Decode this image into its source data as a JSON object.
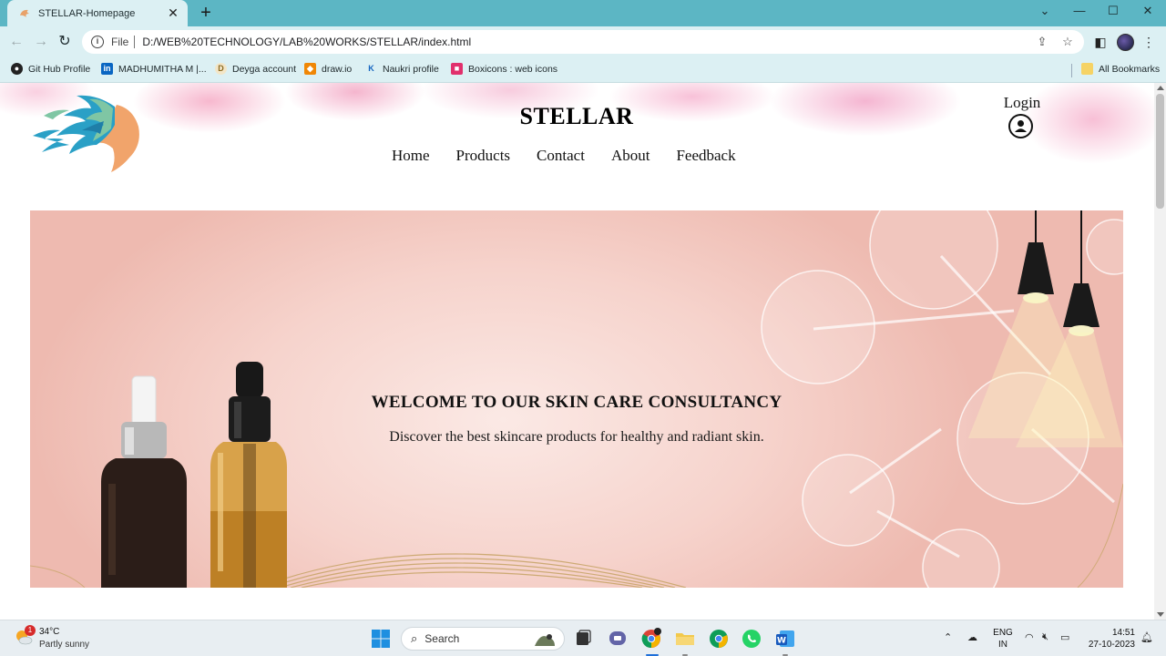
{
  "browser": {
    "tab_title": "STELLAR-Homepage",
    "tab_close": "✕",
    "new_tab": "+",
    "file_label": "File",
    "url": "D:/WEB%20TECHNOLOGY/LAB%20WORKS/STELLAR/index.html",
    "bookmarks": [
      {
        "label": "Git Hub Profile",
        "icon": "github-icon"
      },
      {
        "label": "MADHUMITHA M |...",
        "icon": "linkedin-icon"
      },
      {
        "label": "Deyga account",
        "icon": "deyga-icon"
      },
      {
        "label": "draw.io",
        "icon": "drawio-icon"
      },
      {
        "label": "Naukri profile",
        "icon": "naukri-icon"
      },
      {
        "label": "Boxicons : web icons",
        "icon": "boxicons-icon"
      }
    ],
    "all_bookmarks": "All Bookmarks"
  },
  "site": {
    "brand": "STELLAR",
    "nav": [
      "Home",
      "Products",
      "Contact",
      "About",
      "Feedback"
    ],
    "login": "Login",
    "hero_title": "WELCOME TO OUR SKIN CARE CONSULTANCY",
    "hero_subtitle": "Discover the best skincare products for healthy and radiant skin."
  },
  "taskbar": {
    "temperature": "34°C",
    "condition": "Partly sunny",
    "weather_badge": "1",
    "search_placeholder": "Search",
    "lang_line1": "ENG",
    "lang_line2": "IN",
    "time": "14:51",
    "date": "27-10-2023"
  },
  "colors": {
    "tabstrip": "#5cb6c4",
    "toolbar": "#dcf0f3",
    "hero_pink": "#f6d3cc"
  }
}
